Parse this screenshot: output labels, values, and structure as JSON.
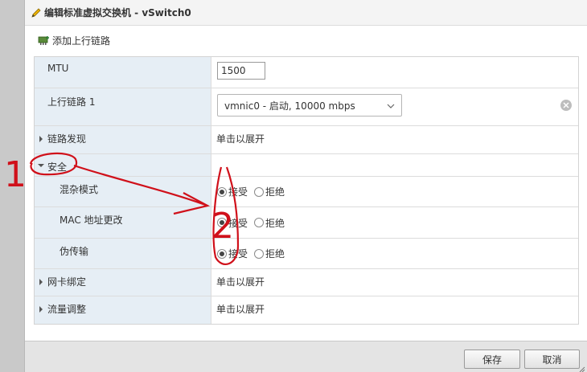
{
  "dialog": {
    "title": "编辑标准虚拟交换机 - vSwitch0"
  },
  "toolbar": {
    "add_uplink": "添加上行链路"
  },
  "rows": {
    "mtu": {
      "label": "MTU",
      "value": "1500"
    },
    "uplink": {
      "label": "上行链路 1",
      "selected": "vmnic0 - 启动, 10000 mbps"
    },
    "link_discovery": {
      "label": "链路发现",
      "value": "单击以展开"
    },
    "security": {
      "label": "安全"
    },
    "promiscuous": {
      "label": "混杂模式",
      "accept": "接受",
      "reject": "拒绝"
    },
    "mac_change": {
      "label": "MAC 地址更改",
      "accept": "接受",
      "reject": "拒绝"
    },
    "forged": {
      "label": "伪传输",
      "accept": "接受",
      "reject": "拒绝"
    },
    "nic_teaming": {
      "label": "网卡绑定",
      "value": "单击以展开"
    },
    "traffic_shaping": {
      "label": "流量调整",
      "value": "单击以展开"
    }
  },
  "footer": {
    "save": "保存",
    "cancel": "取消"
  },
  "annotations": {
    "marker_1": "1",
    "marker_2": "2"
  },
  "colors": {
    "label_column": "#e6eef5",
    "annotation": "#d0101a"
  }
}
